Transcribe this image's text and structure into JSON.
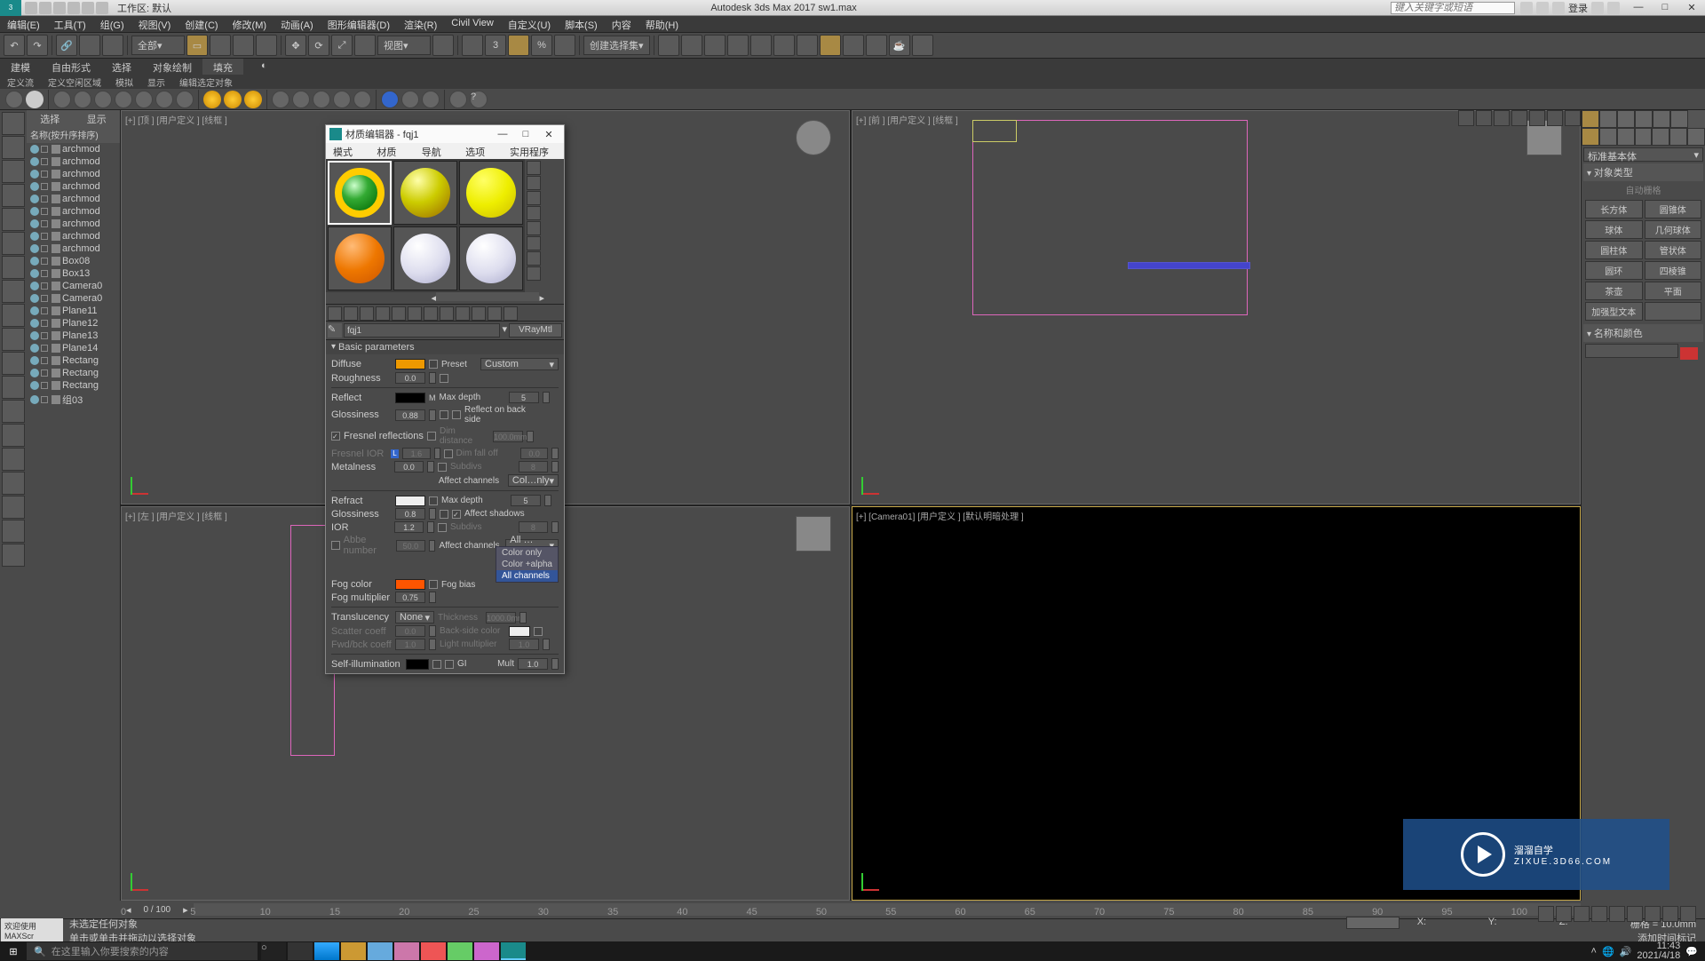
{
  "app": {
    "title": "Autodesk 3ds Max 2017    sw1.max",
    "workspace_label": "工作区: 默认",
    "search_placeholder": "键入关键字或短语",
    "login": "登录"
  },
  "winbtns": {
    "min": "—",
    "max": "□",
    "close": "✕"
  },
  "menu": [
    "编辑(E)",
    "工具(T)",
    "组(G)",
    "视图(V)",
    "创建(C)",
    "修改(M)",
    "动画(A)",
    "图形编辑器(D)",
    "渲染(R)",
    "Civil View",
    "自定义(U)",
    "脚本(S)",
    "内容",
    "帮助(H)"
  ],
  "toolbar_dropdowns": {
    "filter": "全部",
    "snap": "视图",
    "selmode": "创建选择集"
  },
  "ribbon_tabs": [
    "建模",
    "自由形式",
    "选择",
    "对象绘制",
    "填充"
  ],
  "sub_ribbon": [
    "定义流",
    "定义空闲区域",
    "模拟",
    "显示",
    "编辑选定对象"
  ],
  "scene": {
    "tabs": [
      "选择",
      "显示"
    ],
    "header": "名称(按升序排序)",
    "items": [
      "archmod",
      "archmod",
      "archmod",
      "archmod",
      "archmod",
      "archmod",
      "archmod",
      "archmod",
      "archmod",
      "Box08",
      "Box13",
      "Camera0",
      "Camera0",
      "Plane11",
      "Plane12",
      "Plane13",
      "Plane14",
      "Rectang",
      "Rectang",
      "Rectang",
      "组03"
    ]
  },
  "viewports": {
    "tl": "[+] [顶 ] [用户定义 ] [线框 ]",
    "tr": "[+] [前 ] [用户定义 ] [线框 ]",
    "bl": "[+] [左 ] [用户定义 ] [线框 ]",
    "br": "[+]  [Camera01]  [用户定义 ]  [默认明暗处理 ]"
  },
  "cmdpanel": {
    "dropdown": "标准基本体",
    "roll1": "对象类型",
    "autogrid": "自动栅格",
    "buttons": [
      "长方体",
      "圆锥体",
      "球体",
      "几何球体",
      "圆柱体",
      "管状体",
      "圆环",
      "四棱锥",
      "茶壶",
      "平面",
      "加强型文本",
      ""
    ],
    "roll2": "名称和颜色"
  },
  "timeline": {
    "frame": "0 / 100",
    "ticks": [
      "0",
      "5",
      "10",
      "15",
      "20",
      "25",
      "30",
      "35",
      "40",
      "45",
      "50",
      "55",
      "60",
      "65",
      "70",
      "75",
      "80",
      "85",
      "90",
      "95",
      "100"
    ]
  },
  "status": {
    "line1": "未选定任何对象",
    "line2": "单击或单击并拖动以选择对象",
    "welcome": "欢迎使用 MAXScr",
    "x": "X:",
    "y": "Y:",
    "z": "Z:",
    "grid": "栅格 = 10.0mm",
    "addtime": "添加时间标记"
  },
  "taskbar": {
    "search": "在这里输入你要搜索的内容",
    "time": "11:43",
    "date": "2021/4/18"
  },
  "matdlg": {
    "title": "材质编辑器 - fqj1",
    "menu": [
      "模式(D)",
      "材质(M)",
      "导航(N)",
      "选项(O)",
      "实用程序(U)",
      ""
    ],
    "name": "fqj1",
    "type": "VRayMtl",
    "roll_basic": "Basic parameters",
    "params": {
      "diffuse": "Diffuse",
      "roughness": "Roughness",
      "preset": "Preset",
      "preset_val": "Custom",
      "reflect": "Reflect",
      "glossiness": "Glossiness",
      "fresnel": "Fresnel reflections",
      "fresnel_ior": "Fresnel IOR",
      "metalness": "Metalness",
      "maxdepth": "Max depth",
      "reflback": "Reflect on back side",
      "dimdist": "Dim distance",
      "dimfall": "Dim fall off",
      "subdivs": "Subdivs",
      "affect": "Affect channels",
      "affect_val": "Col…nly",
      "refract": "Refract",
      "ior": "IOR",
      "abbe": "Abbe number",
      "affectshadows": "Affect shadows",
      "affect2_val": "All …nels",
      "fogcolor": "Fog color",
      "fogmult": "Fog multiplier",
      "fogbias": "Fog bias",
      "trans": "Translucency",
      "trans_val": "None",
      "thickness": "Thickness",
      "backcolor": "Back-side color",
      "scatter": "Scatter coeff",
      "fwdbck": "Fwd/bck coeff",
      "lightmult": "Light multiplier",
      "selfillum": "Self-illumination",
      "gi": "GI",
      "mult": "Mult"
    },
    "vals": {
      "rough": "0.0",
      "gloss1": "0.88",
      "fior": "1.6",
      "metal": "0.0",
      "maxd1": "5",
      "dimd": "100.0mm",
      "dimf": "0.0",
      "sub1": "8",
      "gloss2": "0.8",
      "ior": "1.2",
      "abbe": "50.0",
      "maxd2": "5",
      "sub2": "8",
      "fogmult": "0.75",
      "thick": "1000.0mm",
      "scat": "0.0",
      "fwd": "1.0",
      "lmul": "1.0",
      "mult": "1.0"
    },
    "dropdown_items": [
      "Color only",
      "Color +alpha",
      "All channels"
    ]
  },
  "watermark": {
    "brand": "溜溜自学",
    "sub": "ZIXUE.3D66.COM"
  }
}
